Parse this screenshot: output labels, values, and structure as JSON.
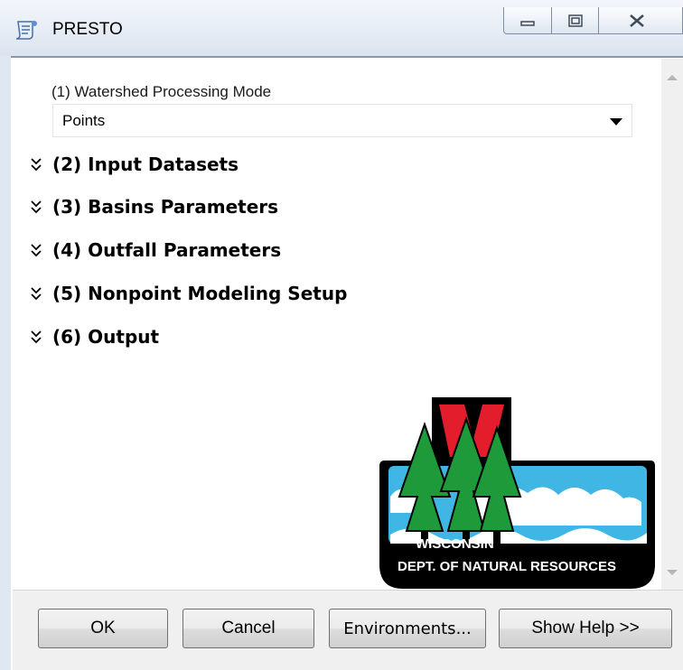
{
  "window": {
    "title": "PRESTO",
    "icon": "script-tool-icon"
  },
  "form": {
    "mode_label": "(1) Watershed Processing Mode",
    "mode_value": "Points",
    "sections": [
      {
        "label": "(2) Input Datasets",
        "icon": "double-chevron-down-icon"
      },
      {
        "label": "(3) Basins Parameters",
        "icon": "double-chevron-down-icon"
      },
      {
        "label": "(4) Outfall Parameters",
        "icon": "double-chevron-down-icon"
      },
      {
        "label": "(5) Nonpoint Modeling Setup",
        "icon": "double-chevron-down-icon"
      },
      {
        "label": "(6) Output",
        "icon": "double-chevron-down-icon"
      }
    ]
  },
  "logo": {
    "line1": "WISCONSIN",
    "line2": "DEPT. OF NATURAL RESOURCES",
    "colors": {
      "red": "#e31d2b",
      "green": "#1f9a3a",
      "water": "#3fb6e3",
      "black": "#000000"
    }
  },
  "buttons": {
    "ok": "OK",
    "cancel": "Cancel",
    "environments": "Environments...",
    "help": "Show Help >>"
  }
}
